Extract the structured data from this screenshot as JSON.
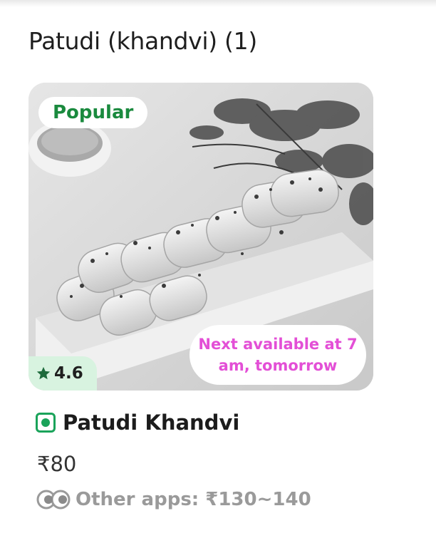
{
  "section": {
    "title": "Patudi (khandvi) (1)"
  },
  "card": {
    "badge": "Popular",
    "availability_line1": "Next available at 7",
    "availability_line2": "am, tomorrow",
    "rating": "4.6",
    "rating_icon": "star-icon"
  },
  "item": {
    "veg_icon": "veg-indicator-icon",
    "name": "Patudi Khandvi",
    "price": "₹80"
  },
  "compare": {
    "icon": "eyes-icon",
    "text": "Other apps: ₹130~140"
  },
  "colors": {
    "popular_green": "#1a8a3e",
    "availability_pink": "#e34fd6",
    "veg_green": "#1aa35a",
    "rating_bg": "#d8f3e0"
  }
}
